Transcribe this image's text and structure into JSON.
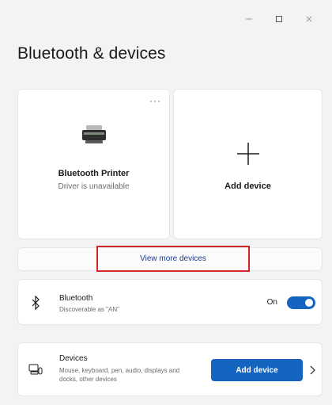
{
  "window": {
    "title": "Bluetooth & devices"
  },
  "devices": {
    "printer": {
      "name": "Bluetooth Printer",
      "status": "Driver is unavailable",
      "icon": "printer-icon",
      "more_label": "···"
    },
    "add_tile": {
      "label": "Add device",
      "icon": "plus-icon"
    },
    "view_more_label": "View more devices"
  },
  "bluetooth": {
    "title": "Bluetooth",
    "subtitle": "Discoverable as \"AN\"",
    "state_label": "On",
    "enabled": true,
    "icon": "bluetooth-icon"
  },
  "devices_section": {
    "title": "Devices",
    "subtitle": "Mouse, keyboard, pen, audio, displays and docks, other devices",
    "button_label": "Add device",
    "icon": "devices-icon"
  },
  "colors": {
    "accent": "#1565c0",
    "highlight": "#d0272d",
    "background": "#f3f3f3",
    "card": "#ffffff"
  }
}
